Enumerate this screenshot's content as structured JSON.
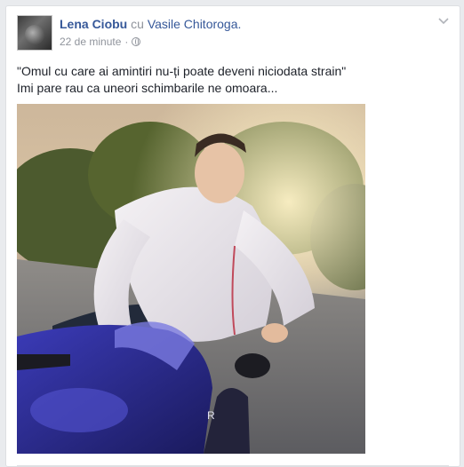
{
  "post": {
    "author": "Lena Ciobu",
    "with_word": "cu",
    "tagged": "Vasile Chitoroga.",
    "time": "22 de minute",
    "separator": "·",
    "privacy_icon": "globe-icon",
    "menu_icon": "chevron-down-icon",
    "text_line1": "\"Omul cu care ai amintiri nu-ți poate deveni niciodata strain\"",
    "text_line2": "Imi pare rau ca uneori schimbarile ne omoara..."
  },
  "colors": {
    "link": "#365899",
    "muted": "#90949c",
    "text": "#1d2129",
    "page_bg": "#e9ebee"
  }
}
